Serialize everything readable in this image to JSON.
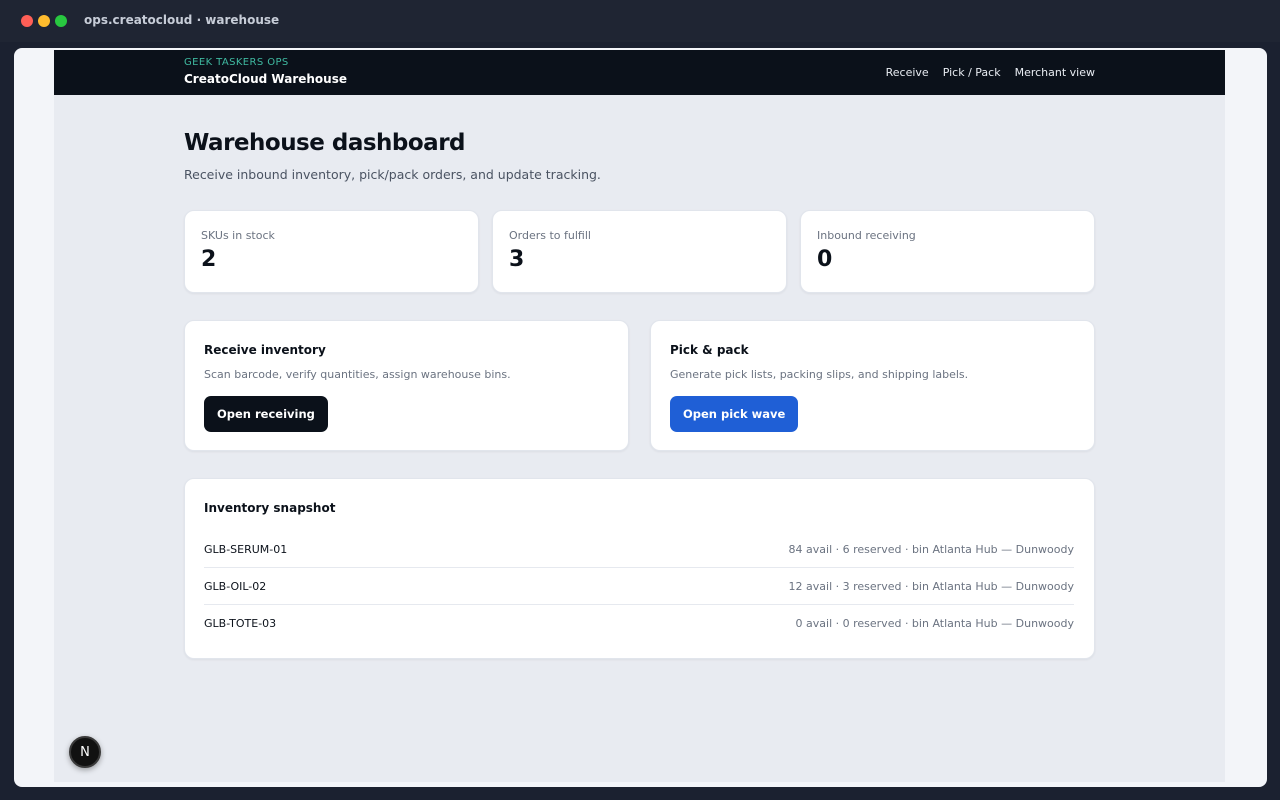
{
  "window": {
    "title": "ops.creatocloud · warehouse"
  },
  "nav": {
    "kicker": "GEEK TASKERS OPS",
    "title": "CreatoCloud Warehouse",
    "links": [
      "Receive",
      "Pick / Pack",
      "Merchant view"
    ]
  },
  "header": {
    "title": "Warehouse dashboard",
    "subtitle": "Receive inbound inventory, pick/pack orders, and update tracking."
  },
  "stats": [
    {
      "label": "SKUs in stock",
      "value": "2"
    },
    {
      "label": "Orders to fulfill",
      "value": "3"
    },
    {
      "label": "Inbound receiving",
      "value": "0"
    }
  ],
  "actions": [
    {
      "title": "Receive inventory",
      "description": "Scan barcode, verify quantities, assign warehouse bins.",
      "button": "Open receiving"
    },
    {
      "title": "Pick & pack",
      "description": "Generate pick lists, packing slips, and shipping labels.",
      "button": "Open pick wave"
    }
  ],
  "inventory": {
    "title": "Inventory snapshot",
    "rows": [
      {
        "sku": "GLB-SERUM-01",
        "meta": "84 avail · 6 reserved · bin Atlanta Hub — Dunwoody"
      },
      {
        "sku": "GLB-OIL-02",
        "meta": "12 avail · 3 reserved · bin Atlanta Hub — Dunwoody"
      },
      {
        "sku": "GLB-TOTE-03",
        "meta": "0 avail · 0 reserved · bin Atlanta Hub — Dunwoody"
      }
    ]
  },
  "badge": {
    "label": "N"
  },
  "colors": {
    "accent_blue": "#1f5fd6",
    "dark": "#0b111a",
    "kicker_teal": "#3fb9a0"
  }
}
